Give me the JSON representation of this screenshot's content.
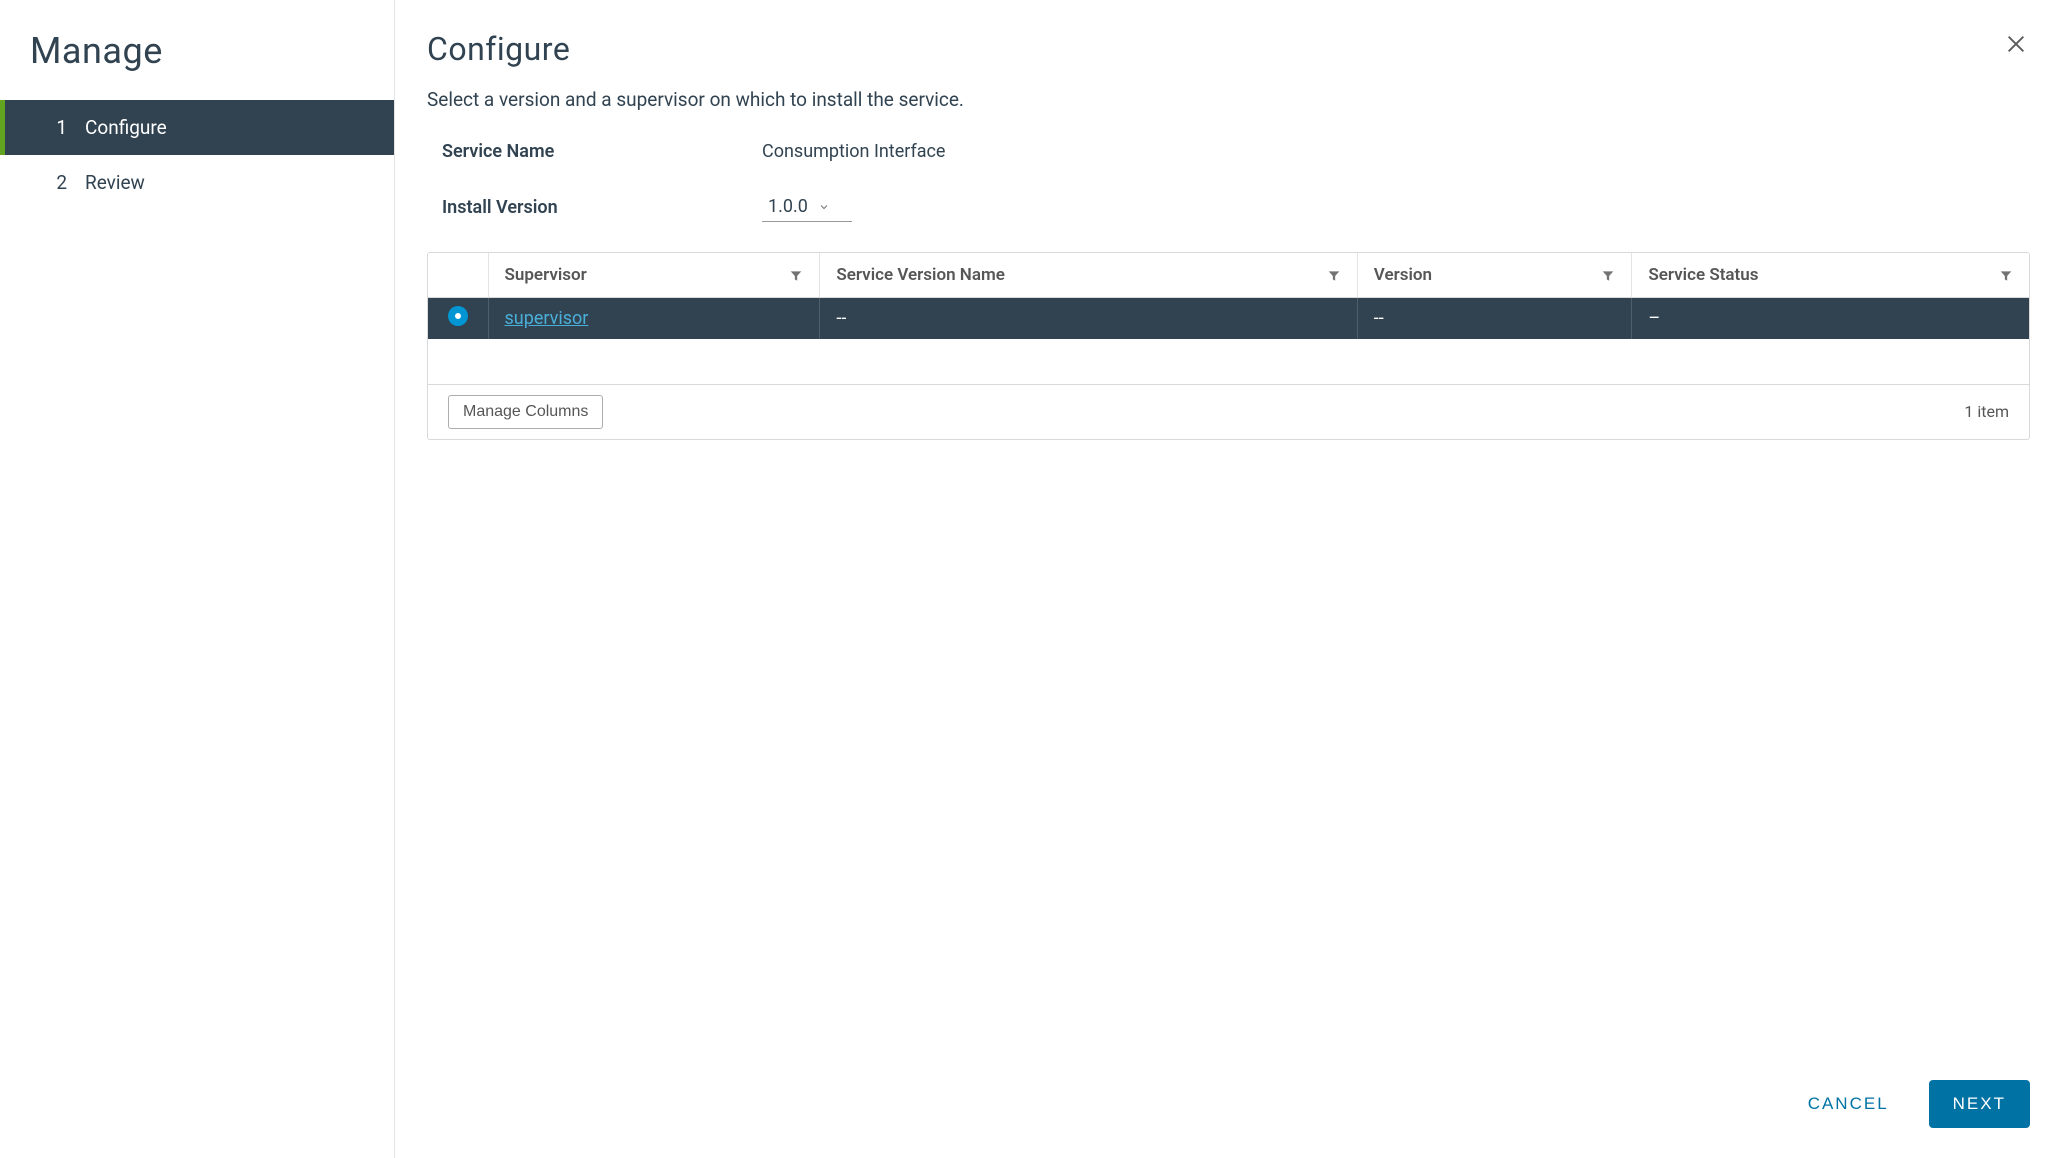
{
  "sidebar": {
    "title": "Manage",
    "steps": [
      {
        "number": "1",
        "label": "Configure"
      },
      {
        "number": "2",
        "label": "Review"
      }
    ]
  },
  "main": {
    "title": "Configure",
    "description": "Select a version and a supervisor on which to install the service.",
    "form": {
      "service_name_label": "Service Name",
      "service_name_value": "Consumption Interface",
      "install_version_label": "Install Version",
      "install_version_value": "1.0.0"
    },
    "table": {
      "columns": {
        "supervisor": "Supervisor",
        "service_version_name": "Service Version Name",
        "version": "Version",
        "service_status": "Service Status"
      },
      "rows": [
        {
          "supervisor": "supervisor",
          "service_version_name": "--",
          "version": "--",
          "service_status": "–"
        }
      ],
      "manage_columns": "Manage Columns",
      "item_count": "1 item"
    },
    "actions": {
      "cancel": "CANCEL",
      "next": "NEXT"
    }
  }
}
